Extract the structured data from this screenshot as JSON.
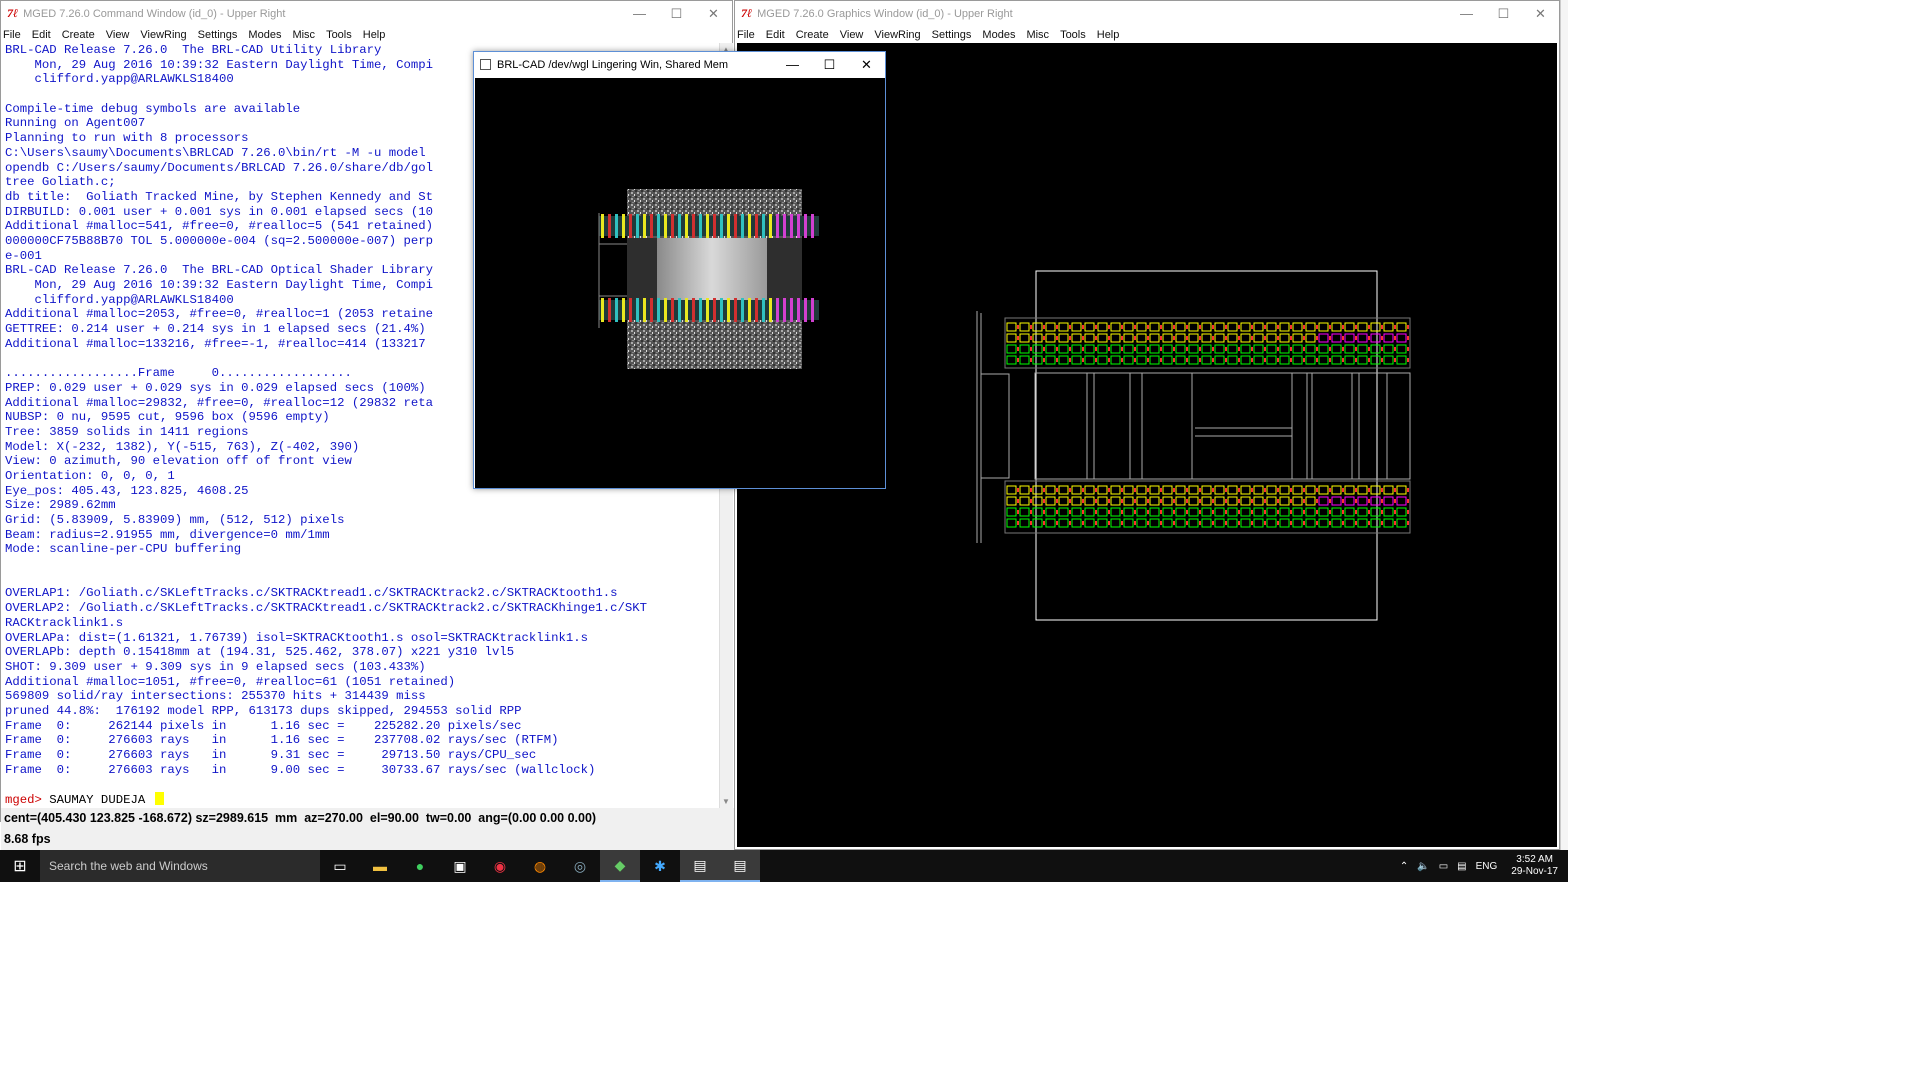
{
  "command_window": {
    "title": "MGED 7.26.0 Command Window (id_0) - Upper Right",
    "menu": [
      "File",
      "Edit",
      "Create",
      "View",
      "ViewRing",
      "Settings",
      "Modes",
      "Misc",
      "Tools",
      "Help"
    ],
    "console_lines": [
      "BRL-CAD Release 7.26.0  The BRL-CAD Utility Library",
      "    Mon, 29 Aug 2016 10:39:32 Eastern Daylight Time, Compi",
      "    clifford.yapp@ARLAWKLS18400",
      "",
      "Compile-time debug symbols are available",
      "Running on Agent007",
      "Planning to run with 8 processors",
      "C:\\Users\\saumy\\Documents\\BRLCAD 7.26.0\\bin/rt -M -u model",
      "opendb C:/Users/saumy/Documents/BRLCAD 7.26.0/share/db/gol",
      "tree Goliath.c;",
      "db title:  Goliath Tracked Mine, by Stephen Kennedy and St",
      "DIRBUILD: 0.001 user + 0.001 sys in 0.001 elapsed secs (10",
      "Additional #malloc=541, #free=0, #realloc=5 (541 retained)",
      "000000CF75B88B70 TOL 5.000000e-004 (sq=2.500000e-007) perp",
      "e-001",
      "BRL-CAD Release 7.26.0  The BRL-CAD Optical Shader Library",
      "    Mon, 29 Aug 2016 10:39:32 Eastern Daylight Time, Compi",
      "    clifford.yapp@ARLAWKLS18400",
      "Additional #malloc=2053, #free=0, #realloc=1 (2053 retaine",
      "GETTREE: 0.214 user + 0.214 sys in 1 elapsed secs (21.4%)",
      "Additional #malloc=133216, #free=-1, #realloc=414 (133217",
      "",
      "..................Frame     0..................",
      "PREP: 0.029 user + 0.029 sys in 0.029 elapsed secs (100%)",
      "Additional #malloc=29832, #free=0, #realloc=12 (29832 reta",
      "NUBSP: 0 nu, 9595 cut, 9596 box (9596 empty)",
      "Tree: 3859 solids in 1411 regions",
      "Model: X(-232, 1382), Y(-515, 763), Z(-402, 390)",
      "View: 0 azimuth, 90 elevation off of front view",
      "Orientation: 0, 0, 0, 1",
      "Eye_pos: 405.43, 123.825, 4608.25",
      "Size: 2989.62mm",
      "Grid: (5.83909, 5.83909) mm, (512, 512) pixels",
      "Beam: radius=2.91955 mm, divergence=0 mm/1mm",
      "Mode: scanline-per-CPU buffering",
      "",
      "",
      "OVERLAP1: /Goliath.c/SKLeftTracks.c/SKTRACKtread1.c/SKTRACKtrack2.c/SKTRACKtooth1.s",
      "OVERLAP2: /Goliath.c/SKLeftTracks.c/SKTRACKtread1.c/SKTRACKtrack2.c/SKTRACKhinge1.c/SKT",
      "RACKtracklink1.s",
      "OVERLAPa: dist=(1.61321, 1.76739) isol=SKTRACKtooth1.s osol=SKTRACKtracklink1.s",
      "OVERLAPb: depth 0.15418mm at (194.31, 525.462, 378.07) x221 y310 lvl5",
      "SHOT: 9.309 user + 9.309 sys in 9 elapsed secs (103.433%)",
      "Additional #malloc=1051, #free=0, #realloc=61 (1051 retained)",
      "569809 solid/ray intersections: 255370 hits + 314439 miss",
      "pruned 44.8%:  176192 model RPP, 613173 dups skipped, 294553 solid RPP",
      "Frame  0:     262144 pixels in      1.16 sec =    225282.20 pixels/sec",
      "Frame  0:     276603 rays   in      1.16 sec =    237708.02 rays/sec (RTFM)",
      "Frame  0:     276603 rays   in      9.31 sec =     29713.50 rays/CPU_sec",
      "Frame  0:     276603 rays   in      9.00 sec =     30733.67 rays/sec (wallclock)",
      ""
    ],
    "prompt": "mged>",
    "input_value": "SAUMAY DUDEJA",
    "status_line": "cent=(405.430 123.825 -168.672) sz=2989.615  mm  az=270.00  el=90.00  tw=0.00  ang=(0.00 0.00 0.00)",
    "fps": "8.68 fps"
  },
  "graphics_window": {
    "title": "MGED 7.26.0 Graphics Window (id_0) - Upper Right",
    "menu": [
      "File",
      "Edit",
      "Create",
      "View",
      "ViewRing",
      "Settings",
      "Modes",
      "Misc",
      "Tools",
      "Help"
    ]
  },
  "raytrace_window": {
    "title": "BRL-CAD /dev/wgl Lingering Win, Shared Mem"
  },
  "window_controls": {
    "minimize": "—",
    "maximize": "☐",
    "close": "✕"
  },
  "taskbar": {
    "search_placeholder": "Search the web and Windows",
    "language": "ENG",
    "time": "3:52 AM",
    "date": "29-Nov-17"
  },
  "colors": {
    "console_text": "#0f14c8",
    "prompt": "#cc0000",
    "track_yellow": "#ffff00",
    "track_green": "#00ff00",
    "track_magenta": "#ff00ff"
  }
}
